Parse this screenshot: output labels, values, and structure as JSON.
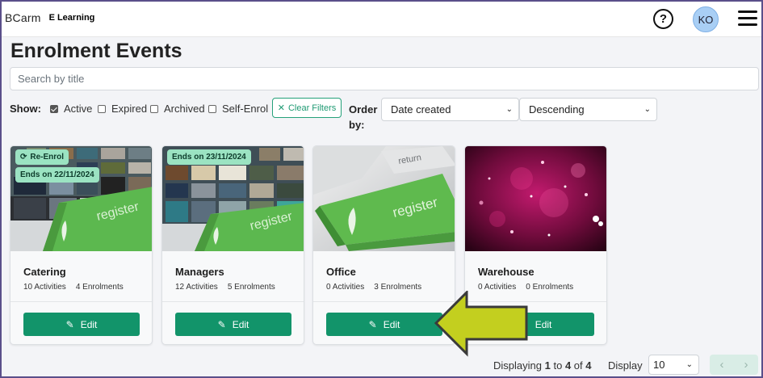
{
  "header": {
    "logo_brand": "BCarm",
    "logo_product": "E Learning",
    "help_symbol": "?",
    "avatar_initials": "KO"
  },
  "page": {
    "title": "Enrolment Events",
    "search_placeholder": "Search by title"
  },
  "filters": {
    "show_label": "Show:",
    "options": [
      {
        "label": "Active",
        "checked": true
      },
      {
        "label": "Expired",
        "checked": false
      },
      {
        "label": "Archived",
        "checked": false
      },
      {
        "label": "Self-Enrol",
        "checked": false
      }
    ],
    "clear_label": "Clear Filters",
    "order_label": "Order by:",
    "order_field": "Date created",
    "order_direction": "Descending"
  },
  "cards": [
    {
      "title": "Catering",
      "activities": "10 Activities",
      "enrolments": "4 Enrolments",
      "badges": [
        "Re-Enrol",
        "Ends on 22/11/2024"
      ],
      "image": "register-keyboard-collage",
      "edit_label": "Edit"
    },
    {
      "title": "Managers",
      "activities": "12 Activities",
      "enrolments": "5 Enrolments",
      "badges": [
        "Ends on 23/11/2024"
      ],
      "image": "register-keyboard-collage",
      "edit_label": "Edit"
    },
    {
      "title": "Office",
      "activities": "0 Activities",
      "enrolments": "3 Enrolments",
      "badges": [],
      "image": "register-keyboard",
      "edit_label": "Edit"
    },
    {
      "title": "Warehouse",
      "activities": "0 Activities",
      "enrolments": "0 Enrolments",
      "badges": [],
      "image": "pink-bokeh",
      "edit_label": "Edit"
    }
  ],
  "footer": {
    "displaying_prefix": "Displaying",
    "range_start": "1",
    "to_word": "to",
    "range_end": "4",
    "of_word": "of",
    "total": "4",
    "display_label": "Display",
    "page_size": "10",
    "prev_symbol": "‹",
    "next_symbol": "›"
  },
  "colors": {
    "accent": "#12946a",
    "badge_bg": "#9be3c2",
    "arrow": "#c3cf1f"
  }
}
